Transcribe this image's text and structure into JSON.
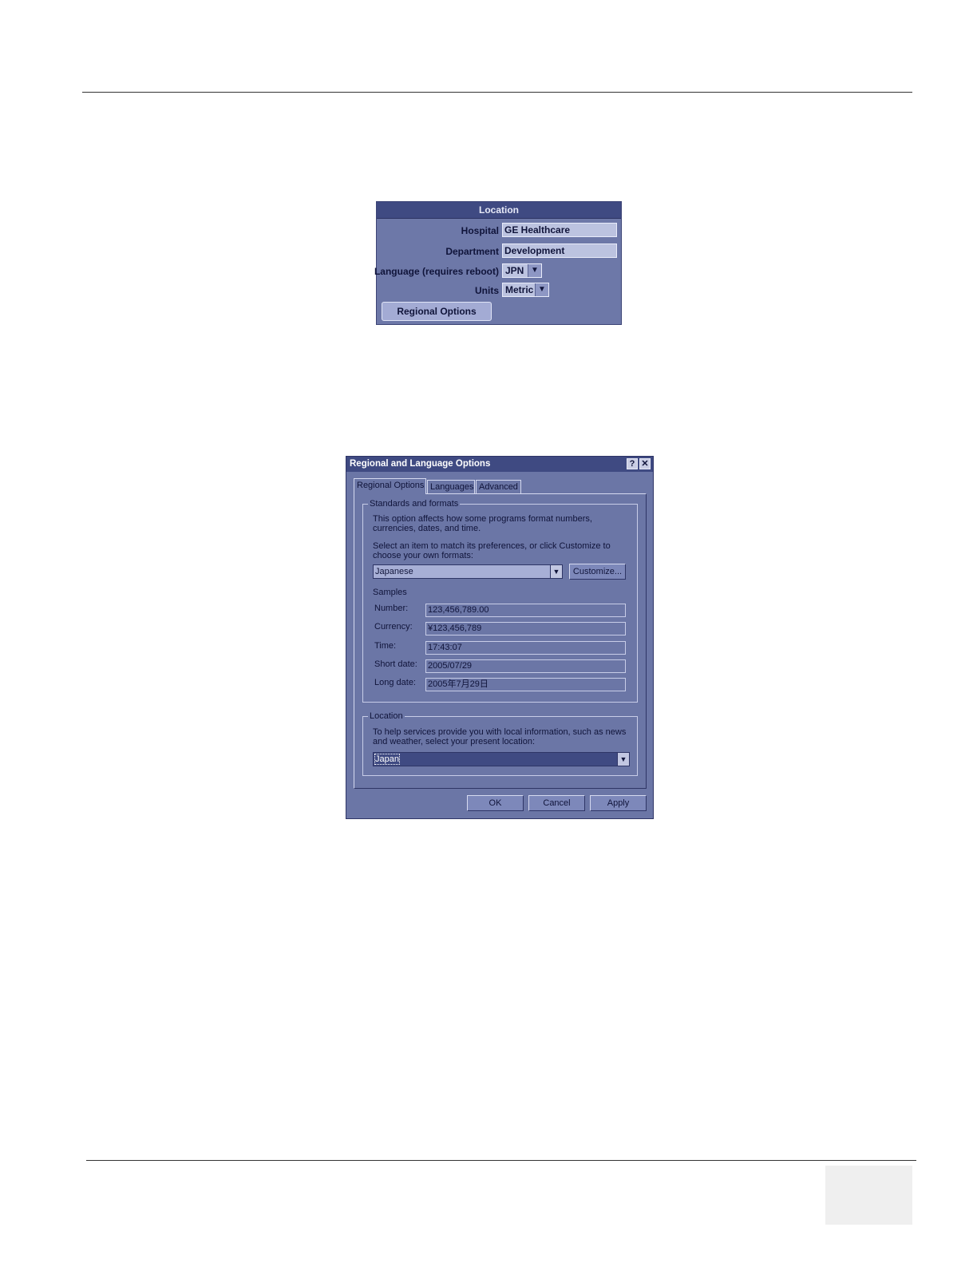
{
  "location_panel": {
    "title": "Location",
    "hospital_label": "Hospital",
    "hospital_value": "GE Healthcare",
    "department_label": "Department",
    "department_value": "Development",
    "language_label": "Language (requires reboot)",
    "language_value": "JPN",
    "units_label": "Units",
    "units_value": "Metric",
    "regional_button": "Regional Options"
  },
  "regional_dialog": {
    "title": "Regional and Language Options",
    "help_icon": "?",
    "close_icon": "✕",
    "tabs": [
      "Regional Options",
      "Languages",
      "Advanced"
    ],
    "standards": {
      "group_title": "Standards and formats",
      "intro": "This option affects how some programs format numbers, currencies, dates, and time.",
      "select_prompt": "Select an item to match its preferences, or click Customize to choose your own formats:",
      "format_value": "Japanese",
      "customize_button": "Customize..."
    },
    "samples": {
      "title": "Samples",
      "rows": [
        {
          "label": "Number:",
          "value": "123,456,789.00"
        },
        {
          "label": "Currency:",
          "value": "¥123,456,789"
        },
        {
          "label": "Time:",
          "value": "17:43:07"
        },
        {
          "label": "Short date:",
          "value": "2005/07/29"
        },
        {
          "label": "Long date:",
          "value": "2005年7月29日"
        }
      ]
    },
    "location": {
      "group_title": "Location",
      "prompt": "To help services provide you with local information, such as news and weather, select your present location:",
      "value": "Japan"
    },
    "buttons": {
      "ok": "OK",
      "cancel": "Cancel",
      "apply": "Apply"
    }
  }
}
